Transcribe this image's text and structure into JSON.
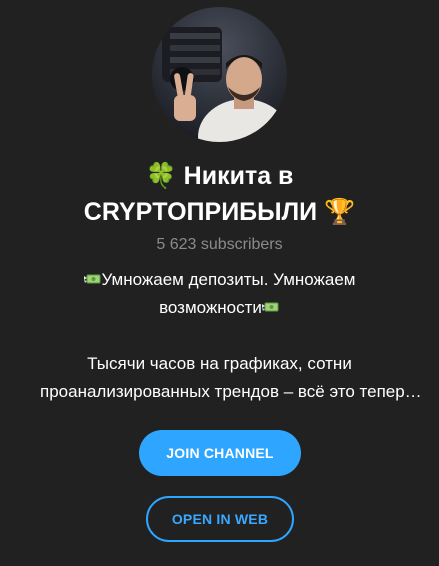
{
  "channel": {
    "title_line1": "Никита в",
    "title_line2": "CRYPTOПРИБЫЛИ",
    "title_emoji_leading": "🍀",
    "title_emoji_trailing": "🏆",
    "subscribers": "5 623 subscribers",
    "description": {
      "line1": "Умножаем депозиты. Умножаем",
      "line2": "возможности",
      "line3": "Тысячи часов на графиках, сотни",
      "line4": "проанализированных трендов – всё это тепер…"
    }
  },
  "buttons": {
    "join_label": "JOIN CHANNEL",
    "web_label": "OPEN IN WEB"
  },
  "colors": {
    "background": "#212121",
    "accent": "#2ea6ff",
    "muted_text": "#8b8b8b"
  },
  "icons": {
    "avatar": "channel-avatar-photo",
    "money": "money-with-wings-icon",
    "clover": "four-leaf-clover-icon",
    "trophy": "trophy-icon"
  }
}
